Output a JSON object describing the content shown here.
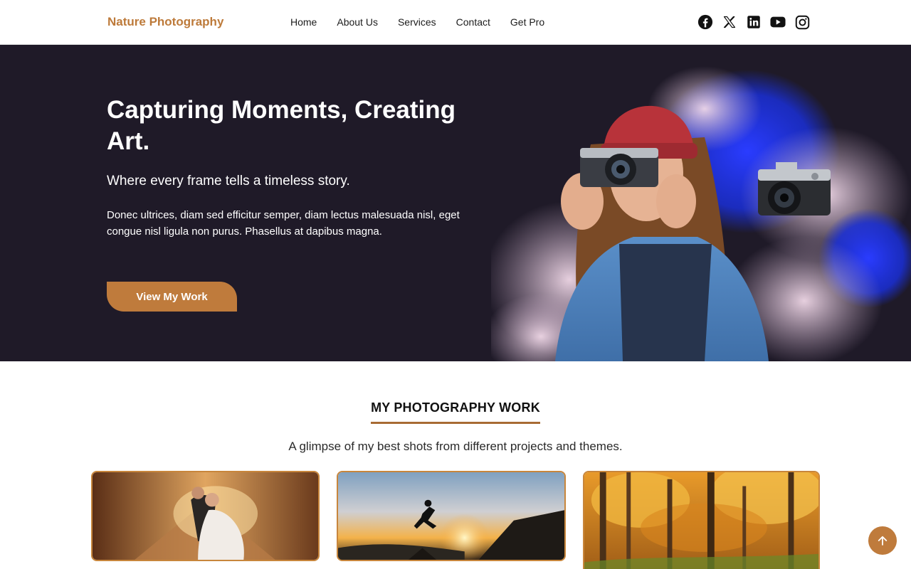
{
  "header": {
    "brand": "Nature Photography",
    "nav": [
      "Home",
      "About Us",
      "Services",
      "Contact",
      "Get Pro"
    ],
    "social_icons": [
      "facebook-icon",
      "x-icon",
      "linkedin-icon",
      "youtube-icon",
      "instagram-icon"
    ]
  },
  "hero": {
    "title": "Capturing Moments, Creating Art.",
    "subtitle": "Where every frame tells a timeless story.",
    "description": "Donec ultrices, diam sed efficitur semper, diam lectus malesuada nisl, eget congue nisl ligula non purus. Phasellus at dapibus magna.",
    "button": "View My Work"
  },
  "work": {
    "title": "MY PHOTOGRAPHY WORK",
    "subtitle": "A glimpse of my best shots from different projects and themes."
  },
  "colors": {
    "accent": "#bf7b3c",
    "hero_bg": "#1f1a28"
  }
}
